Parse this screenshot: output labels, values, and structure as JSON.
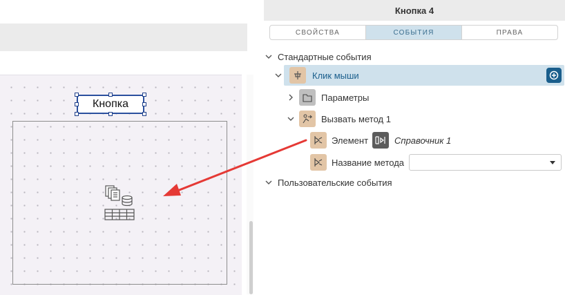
{
  "canvas": {
    "button_label": "Кнопка",
    "grid_icon": "data-grid-icon"
  },
  "panel": {
    "title": "Кнопка 4",
    "tabs": [
      {
        "label": "СВОЙСТВА",
        "active": false
      },
      {
        "label": "СОБЫТИЯ",
        "active": true
      },
      {
        "label": "ПРАВА",
        "active": false
      }
    ],
    "tree": {
      "standard_events": "Стандартные события",
      "mouse_click": "Клик мыши",
      "parameters": "Параметры",
      "call_method": "Вызвать метод 1",
      "element": "Элемент",
      "element_ref": "Справочник 1",
      "method_name": "Название метода",
      "method_value": "",
      "user_events": "Пользовательские события"
    }
  },
  "colors": {
    "accent": "#1a5e8c",
    "tab_active_bg": "#cfe1ec",
    "icon_tan": "#e2c5a6",
    "arrow": "#e53935"
  }
}
